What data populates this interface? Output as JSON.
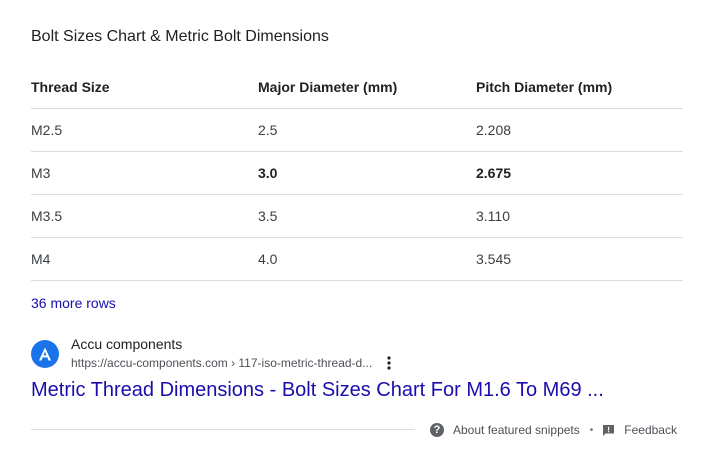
{
  "snippet": {
    "heading": "Bolt Sizes Chart & Metric Bolt Dimensions",
    "table": {
      "headers": [
        "Thread Size",
        "Major Diameter (mm)",
        "Pitch Diameter (mm)"
      ],
      "rows": [
        [
          "M2.5",
          "2.5",
          "2.208"
        ],
        [
          "M3",
          "3.0",
          "2.675"
        ],
        [
          "M3.5",
          "3.5",
          "3.110"
        ],
        [
          "M4",
          "4.0",
          "3.545"
        ]
      ],
      "bold_row_index": 1
    },
    "more_rows_label": "36 more rows"
  },
  "source": {
    "favicon_letter": "A",
    "favicon_color": "#1a73e8",
    "site_name": "Accu components",
    "url": "https://accu-components.com › 117-iso-metric-thread-d...",
    "menu_icon": "more-vert-icon"
  },
  "result": {
    "title": "Metric Thread Dimensions - Bolt Sizes Chart For M1.6 To M69 ...",
    "link_color": "#1a0dab"
  },
  "footer": {
    "about_label": "About featured snippets",
    "separator": "•",
    "feedback_label": "Feedback",
    "about_icon": "help-icon",
    "feedback_icon": "feedback-icon"
  }
}
